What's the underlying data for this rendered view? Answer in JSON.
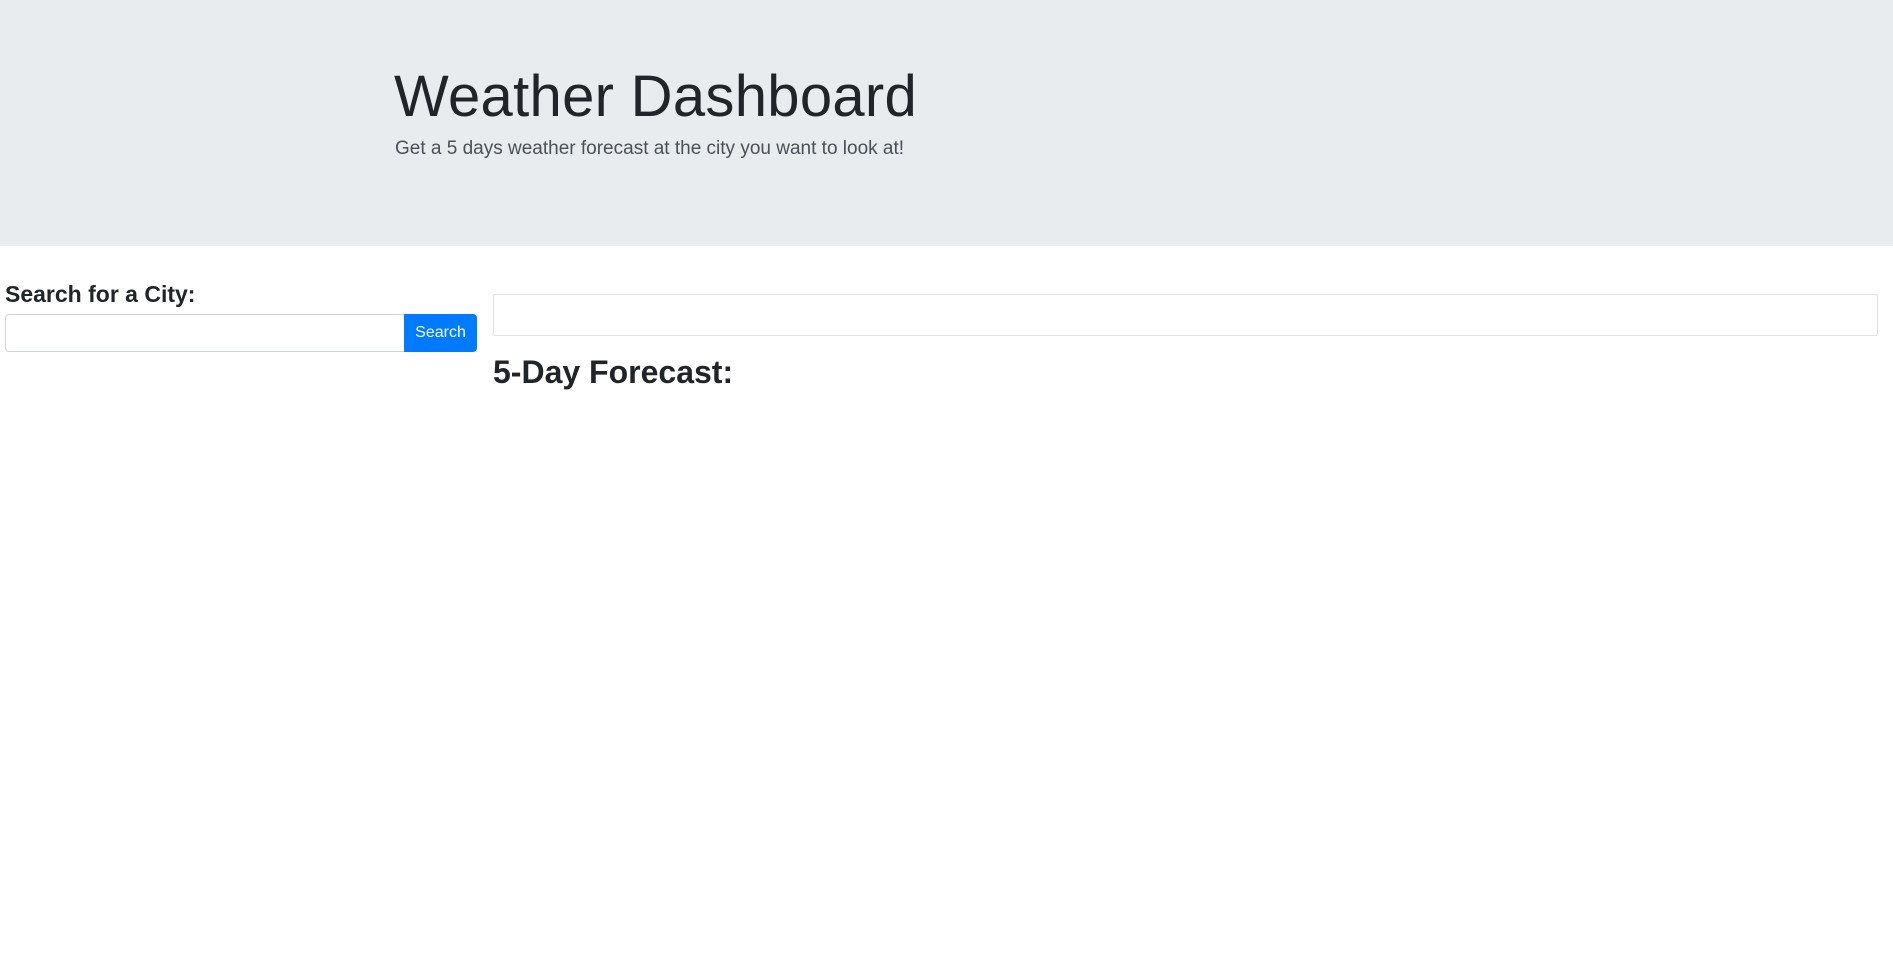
{
  "header": {
    "title": "Weather Dashboard",
    "subtitle": "Get a 5 days weather forecast at the city you want to look at!"
  },
  "search": {
    "label": "Search for a City:",
    "input_value": "",
    "placeholder": "",
    "button_label": "Search"
  },
  "forecast": {
    "heading": "5-Day Forecast:"
  },
  "colors": {
    "jumbotron_bg": "#e9ecef",
    "button_primary": "#007bff",
    "text": "#212529"
  }
}
